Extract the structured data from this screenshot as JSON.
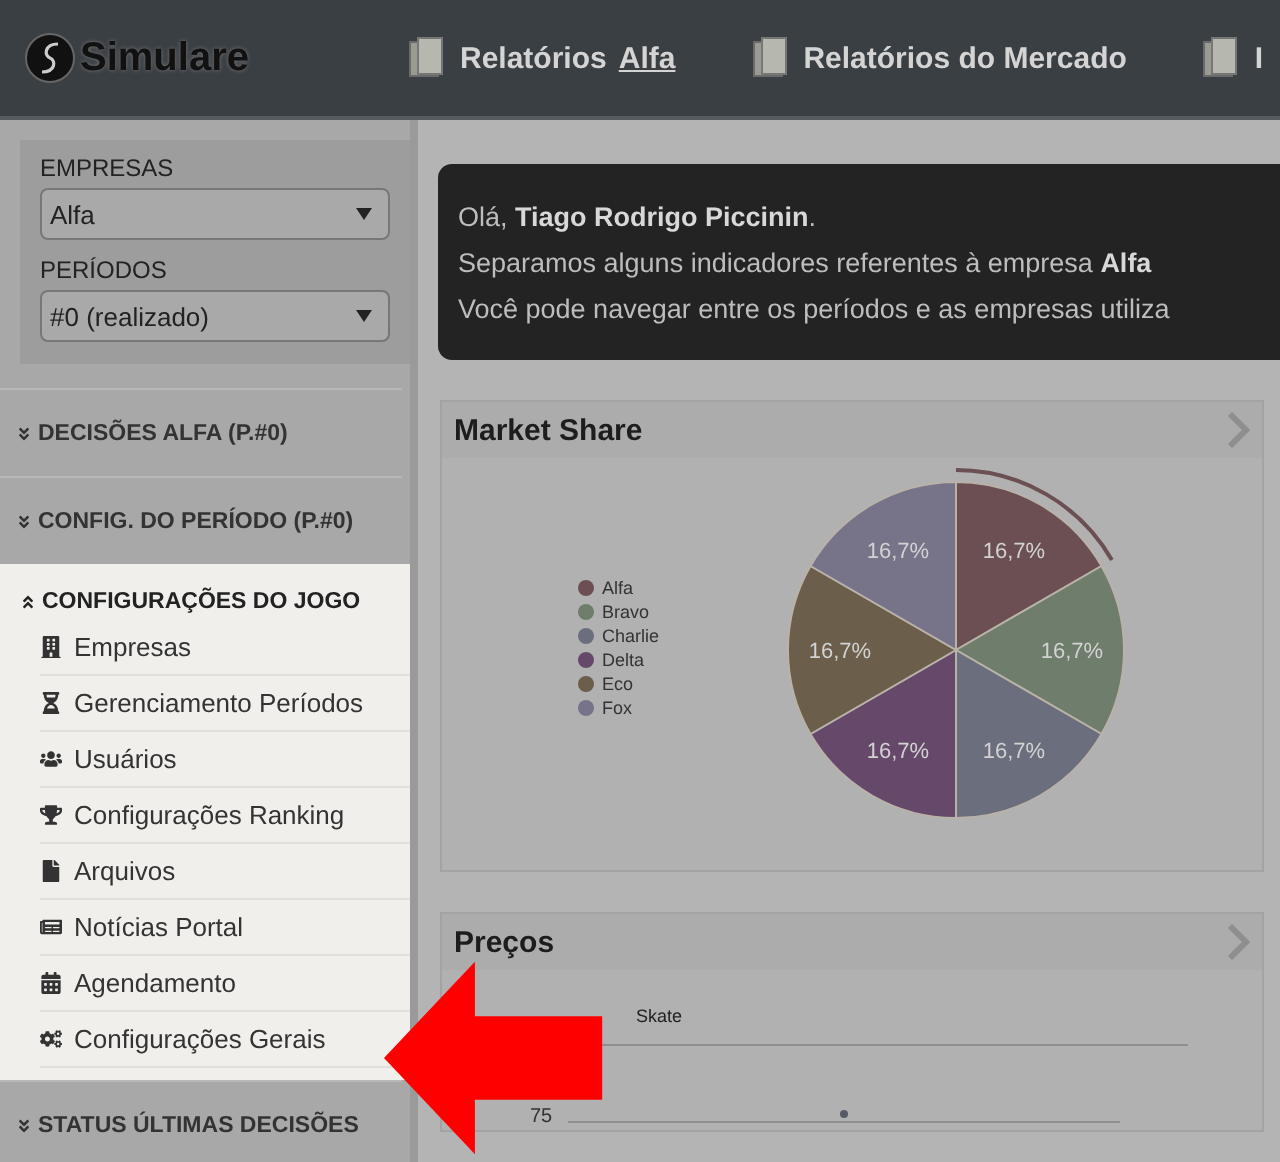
{
  "header": {
    "logo": "Simulare",
    "nav": [
      {
        "label": "Relatórios",
        "underlined": "Alfa"
      },
      {
        "label": "Relatórios do Mercado"
      },
      {
        "label": "I"
      }
    ]
  },
  "sidebar": {
    "filters": [
      {
        "label": "EMPRESAS",
        "value": "Alfa"
      },
      {
        "label": "PERÍODOS",
        "value": "#0 (realizado)"
      }
    ],
    "sections": [
      {
        "title": "DECISÕES ALFA (P.#0)",
        "expanded": false,
        "highlighted": false
      },
      {
        "title": "CONFIG. DO PERÍODO (P.#0)",
        "expanded": false,
        "highlighted": false
      },
      {
        "title": "CONFIGURAÇÕES DO JOGO",
        "expanded": true,
        "highlighted": true,
        "items": [
          "Empresas",
          "Gerenciamento Períodos",
          "Usuários",
          "Configurações Ranking",
          "Arquivos",
          "Notícias Portal",
          "Agendamento",
          "Configurações Gerais"
        ]
      },
      {
        "title": "STATUS ÚLTIMAS DECISÕES",
        "expanded": false,
        "highlighted": false
      }
    ]
  },
  "welcome": {
    "lines": [
      "Olá, **Tiago Rodrigo Piccinin**.",
      "Separamos alguns indicadores referentes à empresa **Alfa**",
      "Você pode navegar entre os períodos e as empresas utiliza"
    ]
  },
  "market_share": {
    "title": "Market Share",
    "legend": [
      {
        "color": "#6b4f52"
      },
      {
        "color": "#6f7d6c"
      },
      {
        "color": "#6b6e7c"
      },
      {
        "color": "#66496a"
      },
      {
        "color": "#6b5e4b"
      },
      {
        "color": "#77748a"
      }
    ],
    "chart_data": {
      "type": "pie",
      "categories": [
        "Alfa",
        "Bravo",
        "Charlie",
        "Delta",
        "Eco",
        "Fox"
      ],
      "values": [
        16.7,
        16.7,
        16.7,
        16.7,
        16.7,
        16.7
      ],
      "value_labels": [
        "16,7%",
        "16,7%",
        "16,7%",
        "16,7%",
        "16,7%",
        "16,7%"
      ]
    }
  },
  "prices": {
    "title": "Preços",
    "legend": "Skate",
    "ytick": "75"
  }
}
